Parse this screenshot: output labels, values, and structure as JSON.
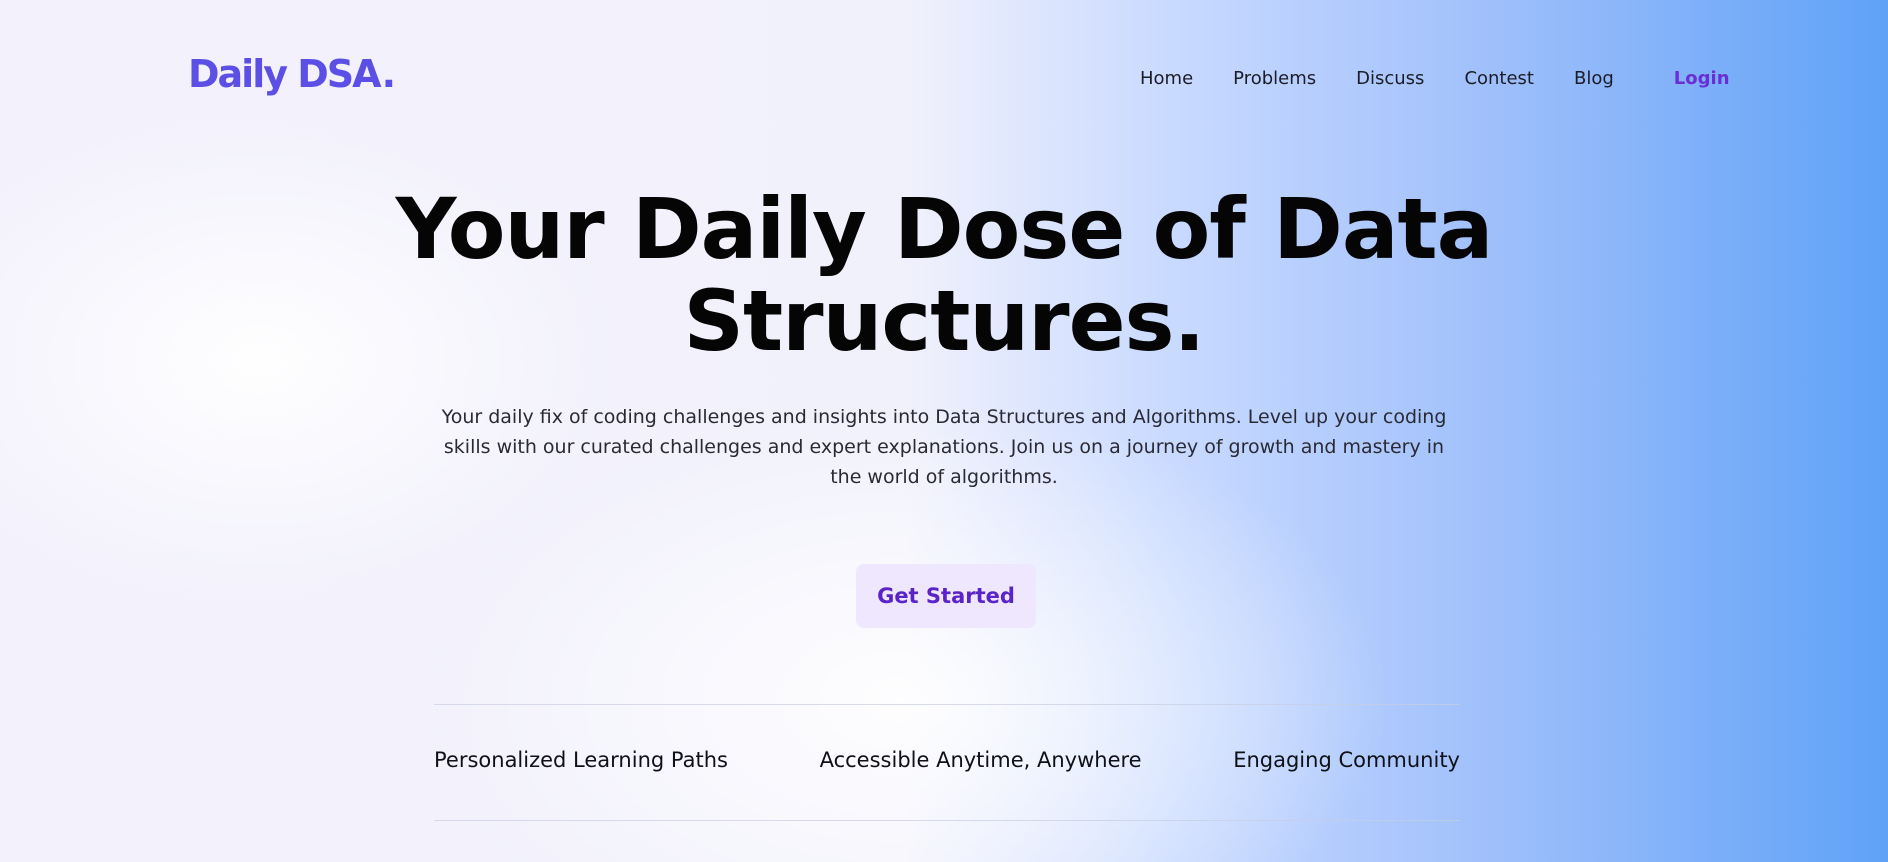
{
  "header": {
    "logo_text": "Daily DSA",
    "logo_dot": ".",
    "nav": [
      "Home",
      "Problems",
      "Discuss",
      "Contest",
      "Blog"
    ],
    "login_label": "Login"
  },
  "hero": {
    "title": "Your Daily Dose of Data Structures.",
    "description": "Your daily fix of coding challenges and insights into Data Structures and Algorithms. Level up your coding skills with our curated challenges and expert explanations. Join us on a journey of growth and mastery in the world of algorithms.",
    "cta_label": "Get Started"
  },
  "features": [
    "Personalized Learning Paths",
    "Accessible Anytime, Anywhere",
    "Engaging Community"
  ],
  "colors": {
    "brand": "#5b4fe6",
    "accent": "#6a2fd4",
    "cta_bg": "#efe7fd",
    "gradient_end": "#5fa2f7"
  }
}
